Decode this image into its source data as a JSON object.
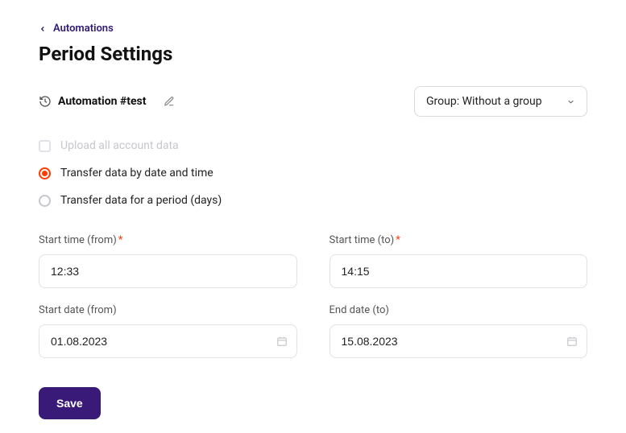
{
  "breadcrumb": {
    "label": "Automations"
  },
  "page_title": "Period Settings",
  "automation": {
    "name": "Automation #test"
  },
  "group_select": {
    "prefix": "Group: ",
    "value": "Without a group"
  },
  "options": {
    "upload_all": "Upload all account data",
    "transfer_datetime": "Transfer data by date and time",
    "transfer_period": "Transfer data for a period (days)"
  },
  "fields": {
    "start_time_from": {
      "label": "Start time (from)",
      "value": "12:33",
      "required": true
    },
    "start_time_to": {
      "label": "Start time (to)",
      "value": "14:15",
      "required": true
    },
    "start_date_from": {
      "label": "Start date (from)",
      "value": "01.08.2023",
      "required": false
    },
    "end_date_to": {
      "label": "End date (to)",
      "value": "15.08.2023",
      "required": false
    }
  },
  "buttons": {
    "save": "Save"
  },
  "required_marker": "*"
}
